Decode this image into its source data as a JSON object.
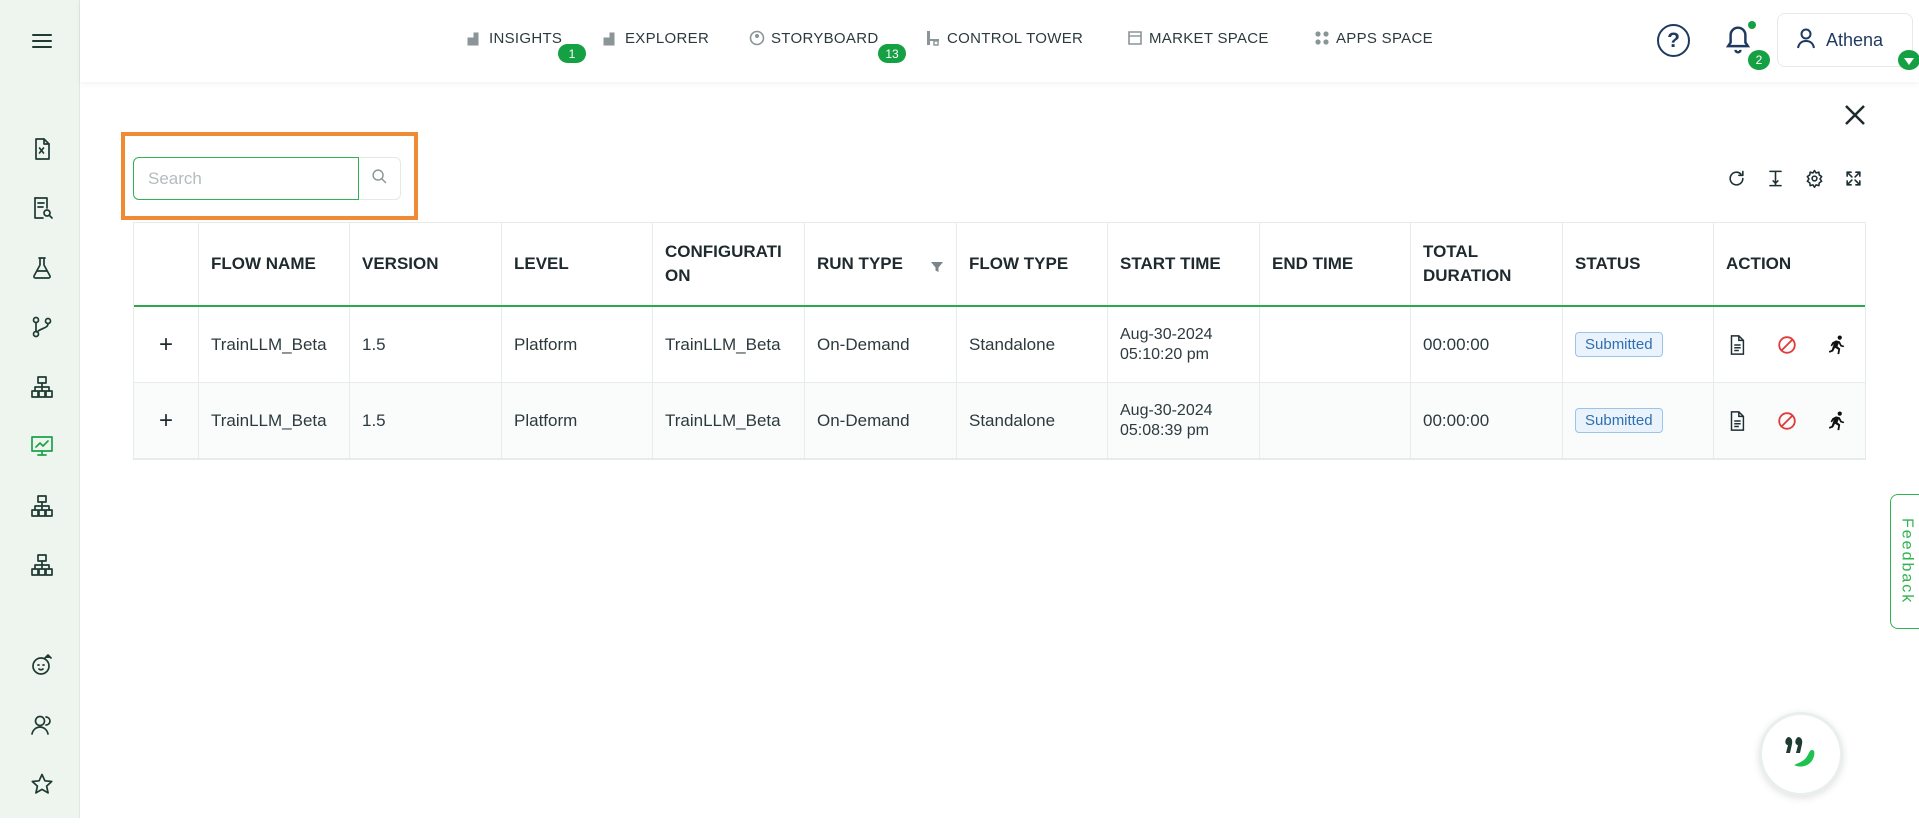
{
  "nav": {
    "items": [
      {
        "label": "INSIGHTS",
        "icon": "bar-chart-icon",
        "badge": "1"
      },
      {
        "label": "EXPLORER",
        "icon": "bar-chart-icon",
        "badge": ""
      },
      {
        "label": "STORYBOARD",
        "icon": "palette-icon",
        "badge": "13"
      },
      {
        "label": "CONTROL TOWER",
        "icon": "tower-icon",
        "badge": ""
      },
      {
        "label": "MARKET SPACE",
        "icon": "store-icon",
        "badge": ""
      },
      {
        "label": "APPS SPACE",
        "icon": "apps-grid-icon",
        "badge": ""
      }
    ]
  },
  "header": {
    "help_label": "?",
    "notifications_count": "2",
    "user_name": "Athena"
  },
  "search": {
    "placeholder": "Search",
    "value": ""
  },
  "table": {
    "columns": [
      "",
      "FLOW NAME",
      "VERSION",
      "LEVEL",
      "CONFIGURATI ON",
      "RUN TYPE",
      "FLOW TYPE",
      "START TIME",
      "END TIME",
      "TOTAL DURATION",
      "STATUS",
      "ACTION"
    ],
    "rows": [
      {
        "expand": "+",
        "flow_name": "TrainLLM_Beta",
        "version": "1.5",
        "level": "Platform",
        "configuration": "TrainLLM_Beta",
        "run_type": "On-Demand",
        "flow_type": "Standalone",
        "start_time": "Aug-30-2024\n05:10:20 pm",
        "end_time": "",
        "total_duration": "00:00:00",
        "status": "Submitted"
      },
      {
        "expand": "+",
        "flow_name": "TrainLLM_Beta",
        "version": "1.5",
        "level": "Platform",
        "configuration": "TrainLLM_Beta",
        "run_type": "On-Demand",
        "flow_type": "Standalone",
        "start_time": "Aug-30-2024\n05:08:39 pm",
        "end_time": "",
        "total_duration": "00:00:00",
        "status": "Submitted"
      }
    ]
  },
  "feedback_label": "Feedback",
  "colors": {
    "accent": "#15a043",
    "highlight": "#f08a33",
    "status_badge": "#2e6fb1",
    "cancel": "#e23b3b"
  }
}
